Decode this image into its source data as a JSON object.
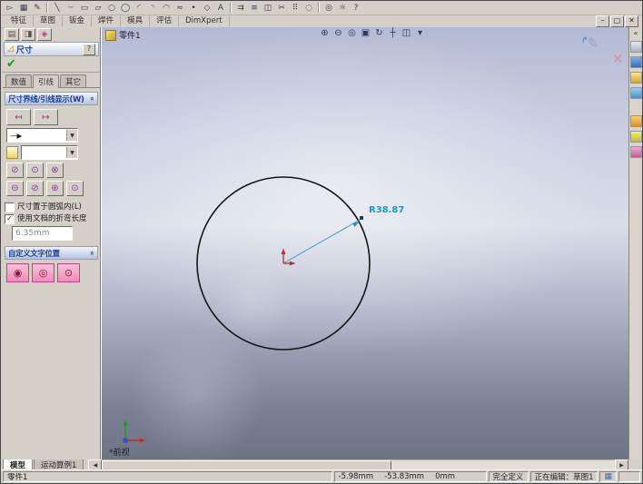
{
  "toolbar": {
    "icons": [
      {
        "name": "select",
        "glyph": "▻"
      },
      {
        "name": "grid",
        "glyph": "▦"
      },
      {
        "name": "sketch",
        "glyph": "✎"
      },
      {
        "name": "line",
        "glyph": "╲"
      },
      {
        "name": "centerline",
        "glyph": "┄"
      },
      {
        "name": "rectangle",
        "glyph": "▭"
      },
      {
        "name": "parallelogram",
        "glyph": "▱"
      },
      {
        "name": "circle",
        "glyph": "○"
      },
      {
        "name": "ellipse",
        "glyph": "◯"
      },
      {
        "name": "centerpoint-arc",
        "glyph": "◜"
      },
      {
        "name": "tangent-arc",
        "glyph": "◝"
      },
      {
        "name": "three-point-arc",
        "glyph": "◠"
      },
      {
        "name": "spline",
        "glyph": "≈"
      },
      {
        "name": "point",
        "glyph": "•"
      },
      {
        "name": "polygon",
        "glyph": "◇"
      },
      {
        "name": "text",
        "glyph": "A"
      },
      {
        "name": "convert-entities",
        "glyph": "⇉"
      },
      {
        "name": "offset-entities",
        "glyph": "≡"
      },
      {
        "name": "mirror-entities",
        "glyph": "◫"
      },
      {
        "name": "trim-entities",
        "glyph": "✂"
      },
      {
        "name": "linear-pattern",
        "glyph": "⠿"
      },
      {
        "name": "circular-pattern",
        "glyph": "◌"
      },
      {
        "name": "quick-snaps",
        "glyph": "◎"
      },
      {
        "name": "options",
        "glyph": "☼"
      },
      {
        "name": "help",
        "glyph": "?"
      }
    ]
  },
  "window_controls": {
    "minimize": "–",
    "restore": "▢",
    "close": "✕"
  },
  "command_tabs": {
    "items": [
      {
        "label": "特征"
      },
      {
        "label": "草图"
      },
      {
        "label": "钣金"
      },
      {
        "label": "焊件"
      },
      {
        "label": "模具"
      },
      {
        "label": "评估"
      },
      {
        "label": "DimXpert"
      }
    ]
  },
  "property_manager": {
    "mini_icons": [
      {
        "glyph": "▤"
      },
      {
        "glyph": "◨"
      },
      {
        "glyph": "◈"
      }
    ],
    "title": "尺寸",
    "title_icon": "◿",
    "help": "?",
    "ok": "✔",
    "tabs": [
      {
        "label": "数值"
      },
      {
        "label": "引线"
      },
      {
        "label": "其它"
      }
    ],
    "group_leaders": {
      "title": "尺寸界线/引线显示(W)",
      "chevron": "«"
    },
    "arrow_buttons": [
      {
        "glyph": "↤"
      },
      {
        "glyph": "↦"
      }
    ],
    "leader_style": {
      "glyph": "—▶",
      "dropdown": "▼"
    },
    "text_style": {
      "dropdown": "▼"
    },
    "radius_options_row1": [
      {
        "glyph": "⊘"
      },
      {
        "glyph": "⊙"
      },
      {
        "glyph": "⊗"
      }
    ],
    "radius_options_row2": [
      {
        "glyph": "⊖"
      },
      {
        "glyph": "⊘"
      },
      {
        "glyph": "⊕"
      },
      {
        "glyph": "⊙"
      }
    ],
    "arc_checkbox": {
      "label": "尺寸置于圆弧内(L)",
      "mark": ""
    },
    "bend_checkbox": {
      "label": "使用文档的折弯长度",
      "mark": "✓"
    },
    "bend_length": {
      "value": "6.35mm"
    },
    "group_text_position": {
      "title": "自定义文字位置",
      "chevron": "«"
    },
    "text_position_buttons": [
      {
        "glyph": "◉"
      },
      {
        "glyph": "◎"
      },
      {
        "glyph": "⊙"
      }
    ]
  },
  "graphics": {
    "doc_tab": {
      "label": "零件1"
    },
    "view_toolbar": [
      {
        "name": "zoom-in",
        "glyph": "⊕"
      },
      {
        "name": "zoom-out",
        "glyph": "⊖"
      },
      {
        "name": "zoom-to-fit",
        "glyph": "◎"
      },
      {
        "name": "zoom-area",
        "glyph": "▣"
      },
      {
        "name": "rotate-view",
        "glyph": "↻"
      },
      {
        "name": "pan",
        "glyph": "┼"
      },
      {
        "name": "section-view",
        "glyph": "◫"
      },
      {
        "name": "view-settings",
        "glyph": "▾"
      }
    ],
    "dimension": {
      "label": "R38.87",
      "color": "#0aa0cc"
    },
    "view_label": "*前视",
    "confirm": {
      "sketch_glyph": "✎",
      "arrow": "↱",
      "close": "✕"
    }
  },
  "task_pane": {
    "chevron": "«"
  },
  "bottom_tabs": {
    "items": [
      {
        "label": "模型"
      },
      {
        "label": "运动算例1"
      }
    ],
    "scroll_left": "◀",
    "scroll_right": "▶"
  },
  "status_bar": {
    "left": "零件1",
    "x": "-5.98mm",
    "y": "-53.83mm",
    "z": "0mm",
    "state": "完全定义",
    "editing": "正在编辑：草图1",
    "icon": "▦"
  }
}
